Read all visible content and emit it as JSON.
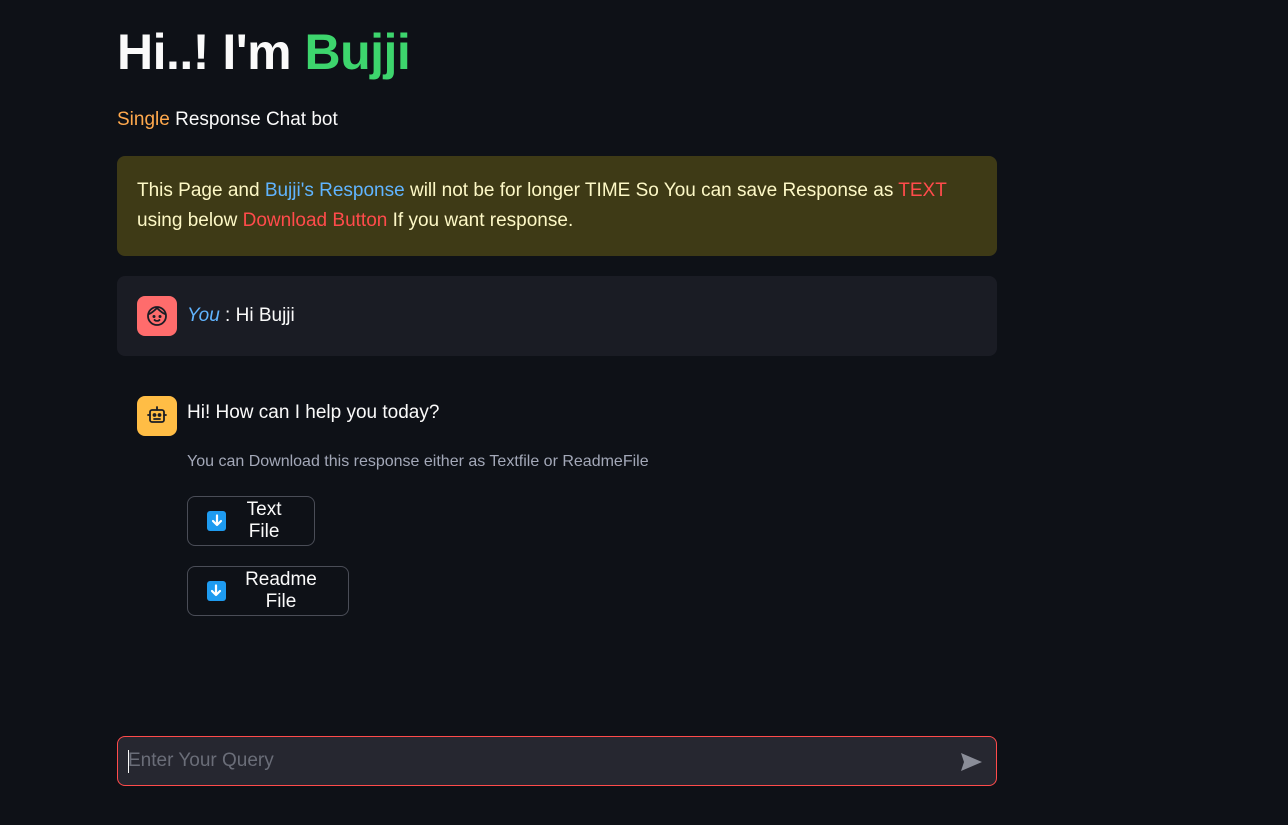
{
  "header": {
    "title_prefix": "Hi..! I'm ",
    "title_name": "Bujji",
    "subtitle_accent": "Single",
    "subtitle_rest": " Response Chat bot"
  },
  "notice": {
    "part1": "This Page and ",
    "highlight1": "Bujji's Response",
    "part2": " will not be for longer TIME So You can save Response as ",
    "highlight2": "TEXT",
    "part3": " using below ",
    "highlight3": "Download Button",
    "part4": " If you want response."
  },
  "chat": {
    "user": {
      "avatar_icon": "face-icon",
      "speaker": "You",
      "separator": " : ",
      "message": "Hi Bujji"
    },
    "assistant": {
      "avatar_icon": "robot-icon",
      "message": "Hi! How can I help you today?",
      "caption": "You can Download this response either as Textfile or ReadmeFile",
      "buttons": [
        {
          "icon": "download-arrow-icon",
          "label": "Text File"
        },
        {
          "icon": "download-arrow-icon",
          "label": "Readme File"
        }
      ]
    }
  },
  "input": {
    "placeholder": "Enter Your Query",
    "value": "",
    "send_icon": "send-icon"
  },
  "colors": {
    "background": "#0e1117",
    "title_accent": "#3dd56d",
    "subtitle_accent": "#ffa94d",
    "notice_bg": "#3e3a16",
    "link_blue": "#60b4ff",
    "alert_red": "#ff4b4b",
    "user_avatar": "#ff6c6c",
    "bot_avatar": "#ffbd45"
  }
}
